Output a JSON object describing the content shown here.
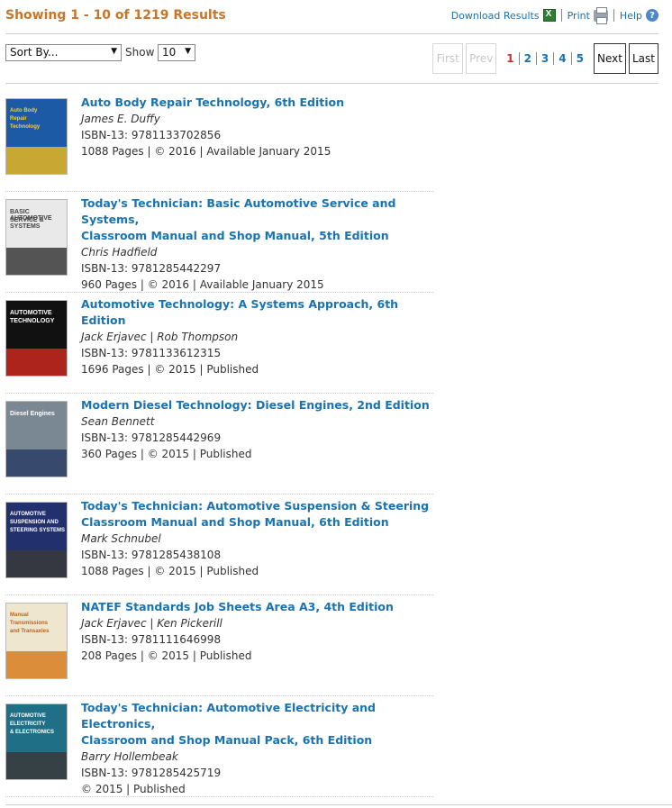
{
  "header": {
    "results_title": "Showing 1 - 10 of 1219 Results",
    "download_label": "Download Results",
    "print_label": "Print",
    "help_label": "Help",
    "help_glyph": "?"
  },
  "controls": {
    "sort_value": "Sort By...",
    "show_label": "Show",
    "show_value": "10",
    "arrow_glyph": "▼"
  },
  "pager": {
    "first": "First",
    "prev": "Prev",
    "pages": [
      "1",
      "2",
      "3",
      "4",
      "5"
    ],
    "current_page": "1",
    "next": "Next",
    "last": "Last"
  },
  "results": [
    {
      "title_lines": [
        "Auto Body Repair Technology, 6th Edition"
      ],
      "author": "James E. Duffy",
      "isbn": "ISBN-13: 9781133702856",
      "details": "1088 Pages | © 2016 |  Available January 2015",
      "cover_text": [
        "Auto Body",
        "Repair",
        "Technology"
      ],
      "cover_color": "#1c5aa6",
      "cover_accent": "#e6b61e"
    },
    {
      "title_lines": [
        "Today's Technician: Basic Automotive Service and Systems,",
        "Classroom Manual and Shop Manual, 5th Edition"
      ],
      "author": "Chris Hadfield",
      "isbn": "ISBN-13: 9781285442297",
      "details": "960 Pages | © 2016 |  Available January 2015",
      "cover_text": [
        "BASIC AUTOMOTIVE",
        "SERVICE & SYSTEMS"
      ],
      "cover_color": "#e9e9e9",
      "cover_accent": "#3a3a3a"
    },
    {
      "title_lines": [
        "Automotive Technology: A Systems Approach, 6th Edition"
      ],
      "author": "Jack Erjavec | Rob Thompson",
      "isbn": "ISBN-13: 9781133612315",
      "details": "1696 Pages | © 2015 |  Published",
      "cover_text": [
        "AUTOMOTIVE",
        "TECHNOLOGY"
      ],
      "cover_color": "#111111",
      "cover_accent": "#c8281e"
    },
    {
      "title_lines": [
        "Modern Diesel Technology: Diesel Engines, 2nd Edition"
      ],
      "author": "Sean Bennett",
      "isbn": "ISBN-13: 9781285442969",
      "details": "360 Pages | © 2015 |  Published",
      "cover_text": [
        "Diesel Engines"
      ],
      "cover_color": "#7a8894",
      "cover_accent": "#2c3e66"
    },
    {
      "title_lines": [
        "Today's Technician: Automotive Suspension & Steering",
        "Classroom Manual and Shop Manual, 6th Edition"
      ],
      "author": "Mark Schnubel",
      "isbn": "ISBN-13: 9781285438108",
      "details": "1088 Pages | © 2015 |  Published",
      "cover_text": [
        "AUTOMOTIVE",
        "SUSPENSION AND",
        "STEERING SYSTEMS"
      ],
      "cover_color": "#23306e",
      "cover_accent": "#3a3a3a"
    },
    {
      "title_lines": [
        "NATEF Standards Job Sheets Area A3, 4th Edition"
      ],
      "author": "Jack Erjavec | Ken Pickerill",
      "isbn": "ISBN-13: 9781111646998",
      "details": "208 Pages | © 2015 |  Published",
      "cover_text": [
        "Manual",
        "Transmissions",
        "and Transaxles"
      ],
      "cover_color": "#efe6cf",
      "cover_accent": "#d87c1e"
    },
    {
      "title_lines": [
        "Today's Technician: Automotive Electricity and Electronics,",
        "Classroom and Shop Manual Pack, 6th Edition"
      ],
      "author": "Barry Hollembeak",
      "isbn": "ISBN-13: 9781285425719",
      "details": "© 2015 |  Published",
      "cover_text": [
        "AUTOMOTIVE",
        "ELECTRICITY",
        "& ELECTRONICS"
      ],
      "cover_color": "#1f6f86",
      "cover_accent": "#3a3a3a"
    }
  ]
}
